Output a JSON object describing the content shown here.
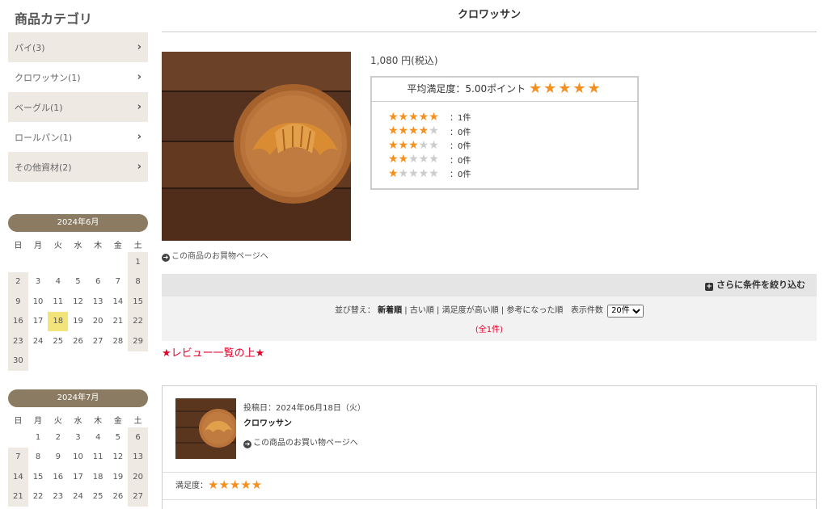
{
  "sidebar": {
    "title": "商品カテゴリ",
    "categories": [
      {
        "label": "パイ(3)"
      },
      {
        "label": "クロワッサン(1)"
      },
      {
        "label": "ベーグル(1)"
      },
      {
        "label": "ロールパン(1)"
      },
      {
        "label": "その他資材(2)"
      }
    ],
    "chevron": "›"
  },
  "calendar_june": {
    "title": "2024年6月",
    "weekdays": [
      "日",
      "月",
      "火",
      "水",
      "木",
      "金",
      "土"
    ],
    "weeks": [
      [
        "",
        "",
        "",
        "",
        "",
        "",
        "1"
      ],
      [
        "2",
        "3",
        "4",
        "5",
        "6",
        "7",
        "8"
      ],
      [
        "9",
        "10",
        "11",
        "12",
        "13",
        "14",
        "15"
      ],
      [
        "16",
        "17",
        "18",
        "19",
        "20",
        "21",
        "22"
      ],
      [
        "23",
        "24",
        "25",
        "26",
        "27",
        "28",
        "29"
      ],
      [
        "30",
        "",
        "",
        "",
        "",
        "",
        ""
      ]
    ],
    "highlight": "18"
  },
  "calendar_july": {
    "title": "2024年7月",
    "weekdays": [
      "日",
      "月",
      "火",
      "水",
      "木",
      "金",
      "土"
    ],
    "weeks": [
      [
        "",
        "1",
        "2",
        "3",
        "4",
        "5",
        "6"
      ],
      [
        "7",
        "8",
        "9",
        "10",
        "11",
        "12",
        "13"
      ],
      [
        "14",
        "15",
        "16",
        "17",
        "18",
        "19",
        "20"
      ],
      [
        "21",
        "22",
        "23",
        "24",
        "25",
        "26",
        "27"
      ]
    ]
  },
  "product": {
    "title": "クロワッサン",
    "image_icon": "croissant-photo",
    "buy_link": "この商品のお買物ページへ",
    "price": "1,080 円(税込)",
    "avg_label": "平均満足度：5.00ポイント",
    "avg_stars": "★★★★★",
    "breakdown": [
      {
        "on": "★★★★★",
        "off": "",
        "count": "：1件"
      },
      {
        "on": "★★★★",
        "off": "★",
        "count": "：0件"
      },
      {
        "on": "★★★",
        "off": "★★",
        "count": "：0件"
      },
      {
        "on": "★★",
        "off": "★★★",
        "count": "：0件"
      },
      {
        "on": "★",
        "off": "★★★★",
        "count": "：0件"
      }
    ]
  },
  "filter": {
    "narrow_label": "さらに条件を絞り込む",
    "sort_label": "並び替え：",
    "sort_options": [
      "新着順",
      "古い順",
      "満足度が高い順",
      "参考になった順"
    ],
    "per_page_label": "表示件数",
    "per_page_value": "20件",
    "total": "(全1件)"
  },
  "note": "★レビュー一覧の上★",
  "review": {
    "date": "投稿日：2024年06月18日（火）",
    "product_name": "クロワッサン",
    "link": "この商品のお買い物ページへ",
    "score_label": "満足度：",
    "score_stars": "★★★★★"
  },
  "colors": {
    "star": "#f58f1e",
    "accent_red": "#e0002a",
    "calendar_head": "#8b7b63",
    "shade": "#efe9e3",
    "today": "#f2e37a"
  }
}
